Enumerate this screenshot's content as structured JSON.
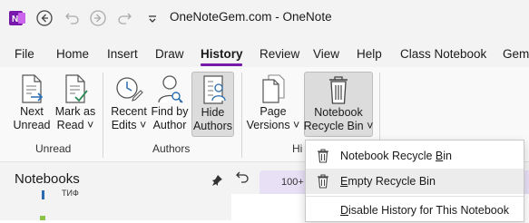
{
  "titlebar": {
    "title": "OneNoteGem.com  -  OneNote"
  },
  "tabs": [
    "File",
    "Home",
    "Insert",
    "Draw",
    "History",
    "Review",
    "View",
    "Help",
    "Class Notebook",
    "Gem"
  ],
  "active_tab": "History",
  "ribbon": {
    "buttons": {
      "next_unread": [
        "Next",
        "Unread"
      ],
      "mark_as_read": [
        "Mark as",
        "Read ˅"
      ],
      "recent_edits": [
        "Recent",
        "Edits ˅"
      ],
      "find_by_author": [
        "Find by",
        "Author"
      ],
      "hide_authors": [
        "Hide",
        "Authors"
      ],
      "page_versions": [
        "Page",
        "Versions ˅"
      ],
      "notebook_recycle_bin": [
        "Notebook",
        "Recycle Bin ˅"
      ]
    },
    "groups": {
      "unread": "Unread",
      "authors": "Authors",
      "history": "Hi"
    }
  },
  "sidebar": {
    "title": "Notebooks",
    "item": "ТИФ"
  },
  "page_tab": {
    "label": "100+"
  },
  "menu": {
    "items": [
      {
        "label": "Notebook Recycle Bin",
        "underline": "B"
      },
      {
        "label": "Empty Recycle Bin",
        "underline": "E"
      },
      {
        "label": "Disable History for This Notebook",
        "underline": "D"
      }
    ]
  },
  "colors": {
    "accent": "#7719aa",
    "icon_blue": "#2b6cb0"
  }
}
